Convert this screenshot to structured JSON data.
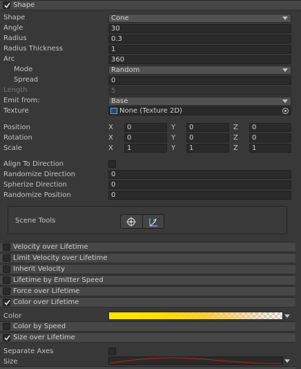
{
  "shape_module": {
    "header": "Shape",
    "enabled": true,
    "shape": {
      "label": "Shape",
      "value": "Cone"
    },
    "angle": {
      "label": "Angle",
      "value": "30"
    },
    "radius": {
      "label": "Radius",
      "value": "0.3"
    },
    "radius_thickness": {
      "label": "Radius Thickness",
      "value": "1"
    },
    "arc": {
      "label": "Arc",
      "value": "360"
    },
    "mode": {
      "label": "Mode",
      "value": "Random"
    },
    "spread": {
      "label": "Spread",
      "value": "0"
    },
    "length": {
      "label": "Length",
      "value": "5"
    },
    "emit_from": {
      "label": "Emit from:",
      "value": "Base"
    },
    "texture": {
      "label": "Texture",
      "value": "None (Texture 2D)"
    },
    "position": {
      "label": "Position",
      "x": "0",
      "y": "0",
      "z": "0"
    },
    "rotation": {
      "label": "Rotation",
      "x": "0",
      "y": "0",
      "z": "0"
    },
    "scale": {
      "label": "Scale",
      "x": "1",
      "y": "1",
      "z": "1"
    },
    "axis_labels": {
      "x": "X",
      "y": "Y",
      "z": "Z"
    },
    "align_to_direction": {
      "label": "Align To Direction",
      "checked": false
    },
    "randomize_direction": {
      "label": "Randomize Direction",
      "value": "0"
    },
    "spherize_direction": {
      "label": "Spherize Direction",
      "value": "0"
    },
    "randomize_position": {
      "label": "Randomize Position",
      "value": "0"
    },
    "scene_tools": {
      "label": "Scene Tools"
    }
  },
  "modules": [
    {
      "label": "Velocity over Lifetime",
      "enabled": false
    },
    {
      "label": "Limit Velocity over Lifetime",
      "enabled": false
    },
    {
      "label": "Inherit Velocity",
      "enabled": false
    },
    {
      "label": "Lifetime by Emitter Speed",
      "enabled": false
    },
    {
      "label": "Force over Lifetime",
      "enabled": false
    },
    {
      "label": "Color over Lifetime",
      "enabled": true
    }
  ],
  "color_over_lifetime": {
    "color_label": "Color"
  },
  "color_by_speed": {
    "label": "Color by Speed",
    "enabled": false
  },
  "size_over_lifetime": {
    "label": "Size over Lifetime",
    "enabled": true,
    "separate_axes": {
      "label": "Separate Axes",
      "checked": false
    },
    "size": {
      "label": "Size"
    }
  },
  "colors": {
    "curve": "#c02020",
    "gradient_start": "#ffe600",
    "panel": "#383838"
  }
}
